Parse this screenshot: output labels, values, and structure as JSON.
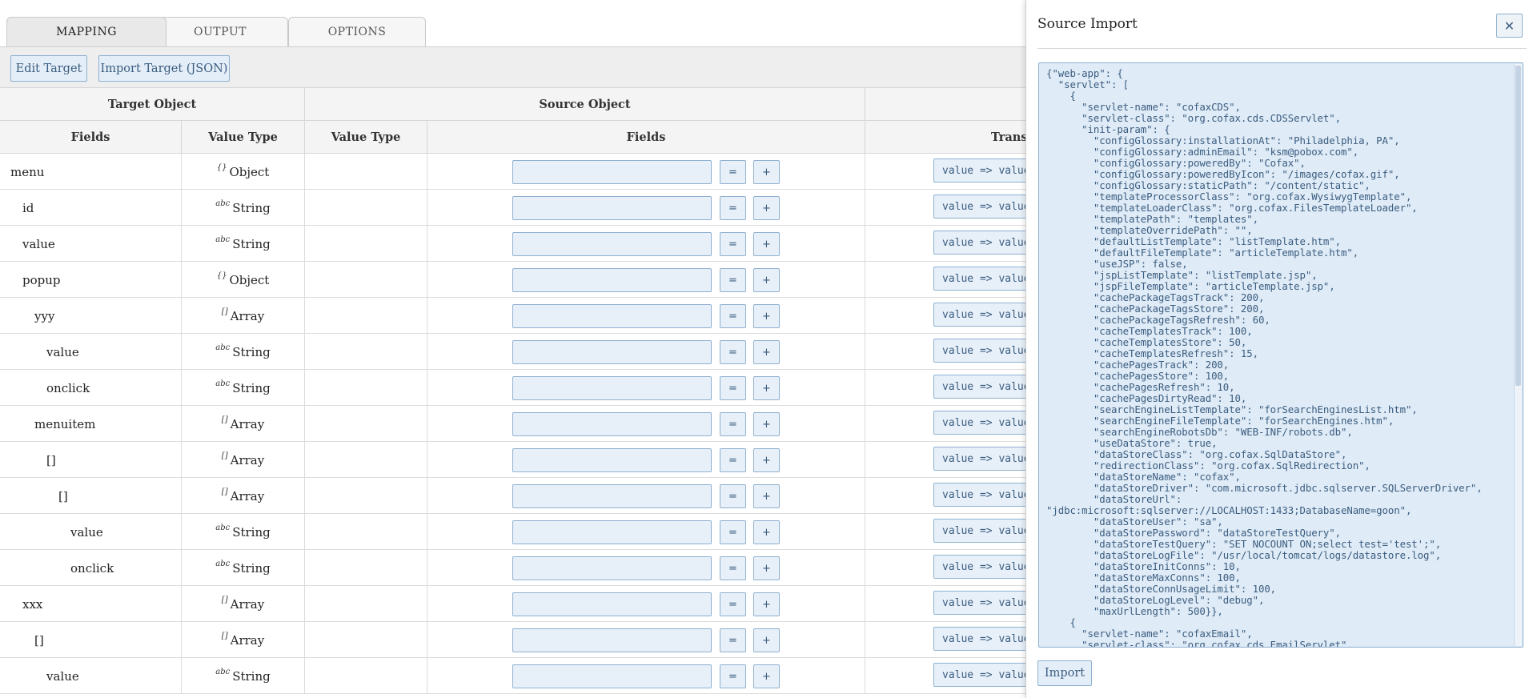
{
  "tabs": [
    {
      "label": "MAPPING",
      "active": true
    },
    {
      "label": "OUTPUT",
      "active": false
    },
    {
      "label": "OPTIONS",
      "active": false
    }
  ],
  "toolbar": {
    "edit_target_label": "Edit Target",
    "import_target_label": "Import Target (JSON)"
  },
  "table": {
    "group_headers": {
      "target": "Target Object",
      "source": "Source Object",
      "transform": "Transf"
    },
    "column_headers": {
      "target_fields": "Fields",
      "target_value_type": "Value Type",
      "source_value_type": "Value Type",
      "source_fields": "Fields",
      "transform": "Transf"
    },
    "equal_button_label": "=",
    "plus_button_label": "+",
    "transform_value": "value => value",
    "rows": [
      {
        "name": "menu",
        "type_icon": "{}",
        "type": "Object",
        "indent": 0
      },
      {
        "name": "id",
        "type_icon": "abc",
        "type": "String",
        "indent": 1
      },
      {
        "name": "value",
        "type_icon": "abc",
        "type": "String",
        "indent": 1
      },
      {
        "name": "popup",
        "type_icon": "{}",
        "type": "Object",
        "indent": 1
      },
      {
        "name": "yyy",
        "type_icon": "[]",
        "type": "Array",
        "indent": 2
      },
      {
        "name": "value",
        "type_icon": "abc",
        "type": "String",
        "indent": 3
      },
      {
        "name": "onclick",
        "type_icon": "abc",
        "type": "String",
        "indent": 3
      },
      {
        "name": "menuitem",
        "type_icon": "[]",
        "type": "Array",
        "indent": 2
      },
      {
        "name": "[]",
        "type_icon": "[]",
        "type": "Array",
        "indent": 3
      },
      {
        "name": "[]",
        "type_icon": "[]",
        "type": "Array",
        "indent": 4
      },
      {
        "name": "value",
        "type_icon": "abc",
        "type": "String",
        "indent": 5
      },
      {
        "name": "onclick",
        "type_icon": "abc",
        "type": "String",
        "indent": 5
      },
      {
        "name": "xxx",
        "type_icon": "[]",
        "type": "Array",
        "indent": 1
      },
      {
        "name": "[]",
        "type_icon": "[]",
        "type": "Array",
        "indent": 2
      },
      {
        "name": "value",
        "type_icon": "abc",
        "type": "String",
        "indent": 3
      }
    ]
  },
  "panel": {
    "title": "Source Import",
    "close_icon": "close-icon",
    "import_label": "Import",
    "json_text": "{\"web-app\": {\n  \"servlet\": [\n    {\n      \"servlet-name\": \"cofaxCDS\",\n      \"servlet-class\": \"org.cofax.cds.CDSServlet\",\n      \"init-param\": {\n        \"configGlossary:installationAt\": \"Philadelphia, PA\",\n        \"configGlossary:adminEmail\": \"ksm@pobox.com\",\n        \"configGlossary:poweredBy\": \"Cofax\",\n        \"configGlossary:poweredByIcon\": \"/images/cofax.gif\",\n        \"configGlossary:staticPath\": \"/content/static\",\n        \"templateProcessorClass\": \"org.cofax.WysiwygTemplate\",\n        \"templateLoaderClass\": \"org.cofax.FilesTemplateLoader\",\n        \"templatePath\": \"templates\",\n        \"templateOverridePath\": \"\",\n        \"defaultListTemplate\": \"listTemplate.htm\",\n        \"defaultFileTemplate\": \"articleTemplate.htm\",\n        \"useJSP\": false,\n        \"jspListTemplate\": \"listTemplate.jsp\",\n        \"jspFileTemplate\": \"articleTemplate.jsp\",\n        \"cachePackageTagsTrack\": 200,\n        \"cachePackageTagsStore\": 200,\n        \"cachePackageTagsRefresh\": 60,\n        \"cacheTemplatesTrack\": 100,\n        \"cacheTemplatesStore\": 50,\n        \"cacheTemplatesRefresh\": 15,\n        \"cachePagesTrack\": 200,\n        \"cachePagesStore\": 100,\n        \"cachePagesRefresh\": 10,\n        \"cachePagesDirtyRead\": 10,\n        \"searchEngineListTemplate\": \"forSearchEnginesList.htm\",\n        \"searchEngineFileTemplate\": \"forSearchEngines.htm\",\n        \"searchEngineRobotsDb\": \"WEB-INF/robots.db\",\n        \"useDataStore\": true,\n        \"dataStoreClass\": \"org.cofax.SqlDataStore\",\n        \"redirectionClass\": \"org.cofax.SqlRedirection\",\n        \"dataStoreName\": \"cofax\",\n        \"dataStoreDriver\": \"com.microsoft.jdbc.sqlserver.SQLServerDriver\",\n        \"dataStoreUrl\":\n\"jdbc:microsoft:sqlserver://LOCALHOST:1433;DatabaseName=goon\",\n        \"dataStoreUser\": \"sa\",\n        \"dataStorePassword\": \"dataStoreTestQuery\",\n        \"dataStoreTestQuery\": \"SET NOCOUNT ON;select test='test';\",\n        \"dataStoreLogFile\": \"/usr/local/tomcat/logs/datastore.log\",\n        \"dataStoreInitConns\": 10,\n        \"dataStoreMaxConns\": 100,\n        \"dataStoreConnUsageLimit\": 100,\n        \"dataStoreLogLevel\": \"debug\",\n        \"maxUrlLength\": 500}},\n    {\n      \"servlet-name\": \"cofaxEmail\",\n      \"servlet-class\": \"org.cofax.cds.EmailServlet\","
  }
}
